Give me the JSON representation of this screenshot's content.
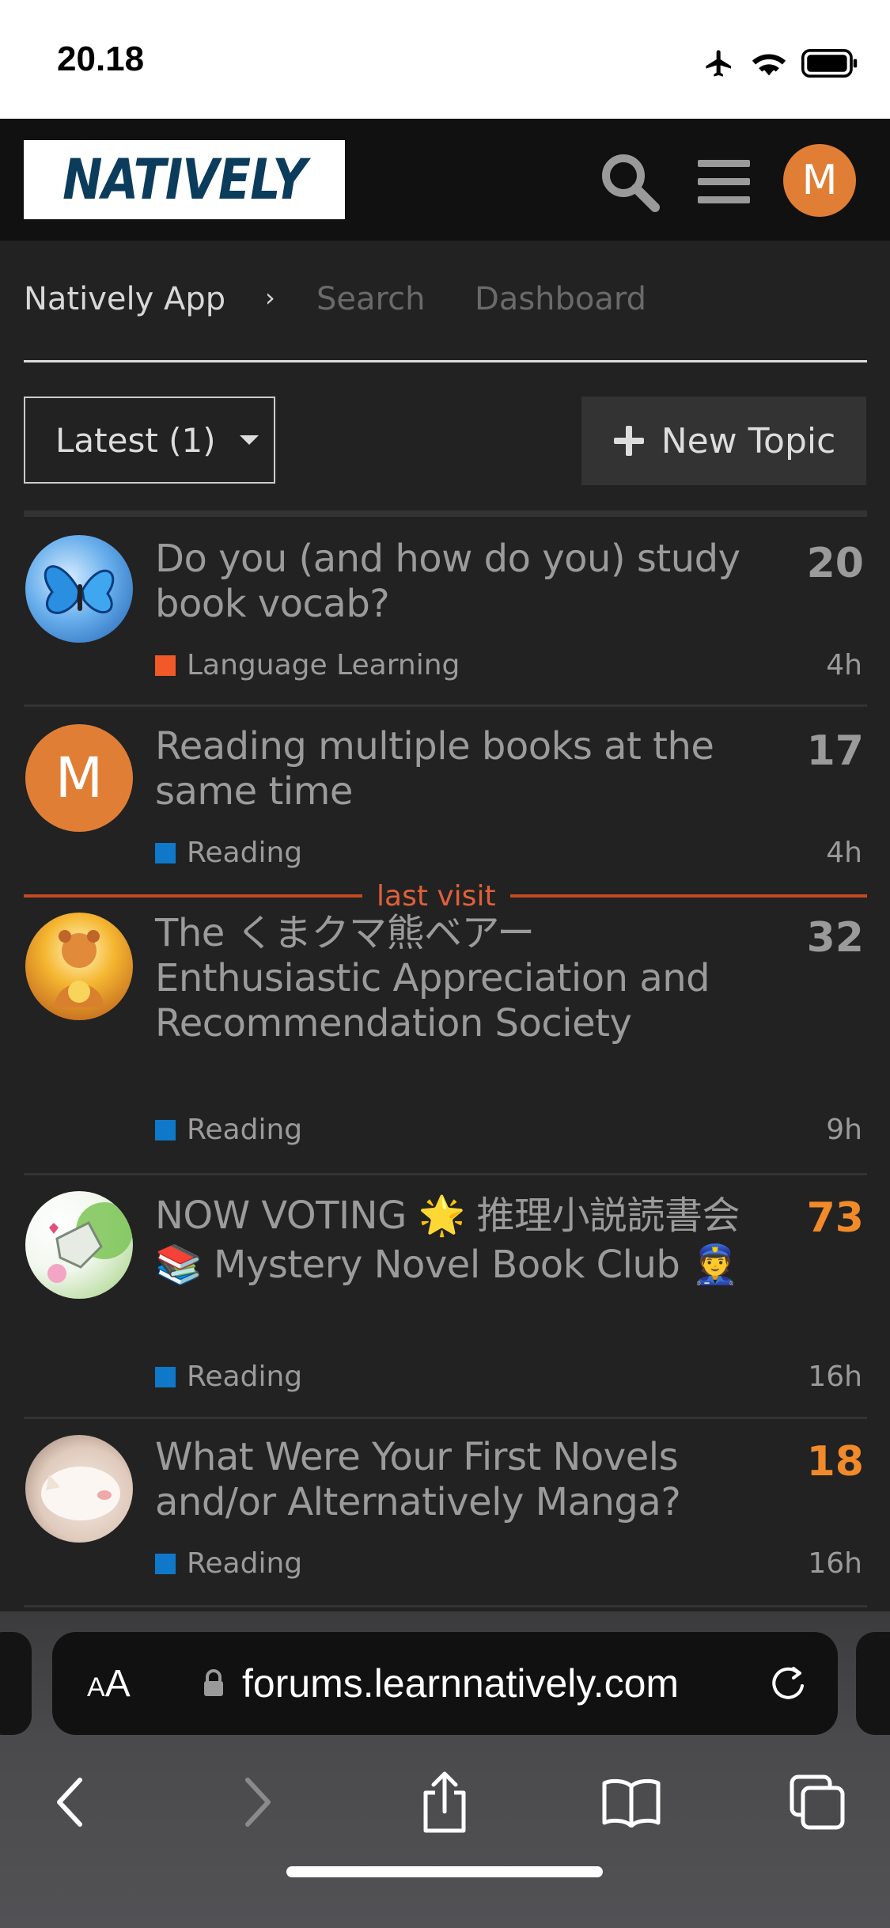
{
  "status_bar": {
    "time": "20.18"
  },
  "header": {
    "logo_text": "NATIVELY",
    "avatar_letter": "M"
  },
  "breadcrumbs": {
    "app": "Natively App",
    "chevron": "›",
    "search": "Search",
    "dashboard": "Dashboard"
  },
  "controls": {
    "filter_label": "Latest (1)",
    "new_topic_label": "New Topic"
  },
  "last_visit_label": "last visit",
  "topics": [
    {
      "title": "Do you (and how do you) study book vocab?",
      "count": "20",
      "category": "Language Learning",
      "category_color": "#f05a28",
      "age": "4h",
      "hot": false
    },
    {
      "title": "Reading multiple books at the same time",
      "count": "17",
      "category": "Reading",
      "category_color": "#0f78c8",
      "age": "4h",
      "hot": false,
      "avatar_letter": "M"
    },
    {
      "title": "The くまクマ熊ベアー Enthusiastic Appreciation and Recommendation Society",
      "count": "32",
      "category": "Reading",
      "category_color": "#0f78c8",
      "age": "9h",
      "hot": false
    },
    {
      "title": "NOW VOTING 🌟 推理小説読書会 📚 Mystery Novel Book Club 👮",
      "count": "73",
      "category": "Reading",
      "category_color": "#0f78c8",
      "age": "16h",
      "hot": true
    },
    {
      "title": "What Were Your First Novels and/or Alternatively Manga?",
      "count": "18",
      "category": "Reading",
      "category_color": "#0f78c8",
      "age": "16h",
      "hot": true
    }
  ],
  "browser": {
    "aa_big": "A",
    "aa_small": "A",
    "url": "forums.learnnatively.com"
  },
  "colors": {
    "accent": "#e17e35",
    "hot_count": "#f08a2a",
    "last_visit": "#c44a20",
    "reading": "#0f78c8",
    "language_learning": "#f05a28"
  }
}
